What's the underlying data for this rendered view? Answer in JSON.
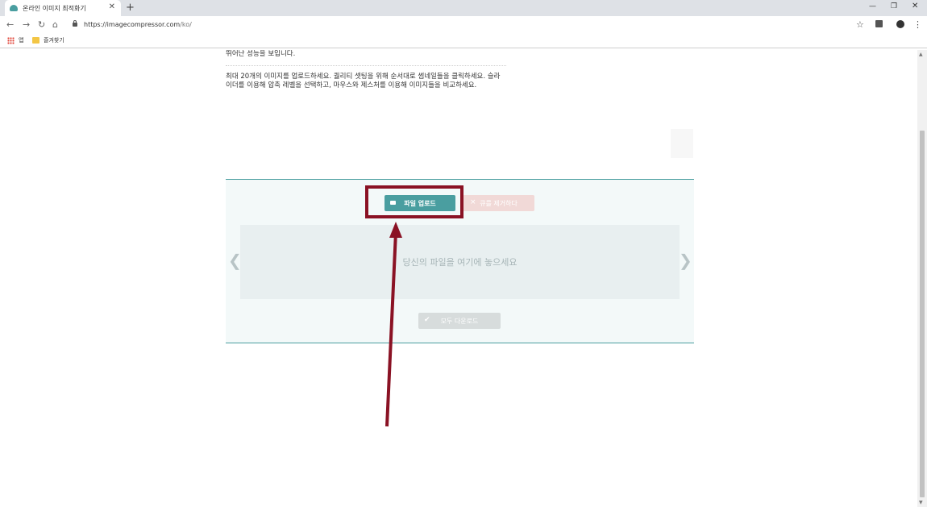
{
  "browser": {
    "tab_title": "온라인 이미지 최적화기",
    "url_host": "https://imagecompressor.com",
    "url_path": "/ko/",
    "bookmarks": [
      "앱",
      "즐겨찾기"
    ]
  },
  "page": {
    "intro_top": "뛰어난 성능을 보입니다.",
    "intro_body": "최대 20개의 이미지를 업로드하세요. 퀄리티 셋팅을 위해 순서대로 썸네일들을 클릭하세요. 슬라이더를 이용해 압축 레벨을 선택하고, 마우스와 제스처를 이용해 이미지들을 비교하세요.",
    "upload_button": "파일 업로드",
    "clear_button": "큐를 제거하다",
    "drop_text": "당신의 파일을 여기에 놓으세요",
    "download_all_button": "모두 다운로드"
  },
  "colors": {
    "accent": "#4a9ea0",
    "annotation": "#8a1224"
  }
}
